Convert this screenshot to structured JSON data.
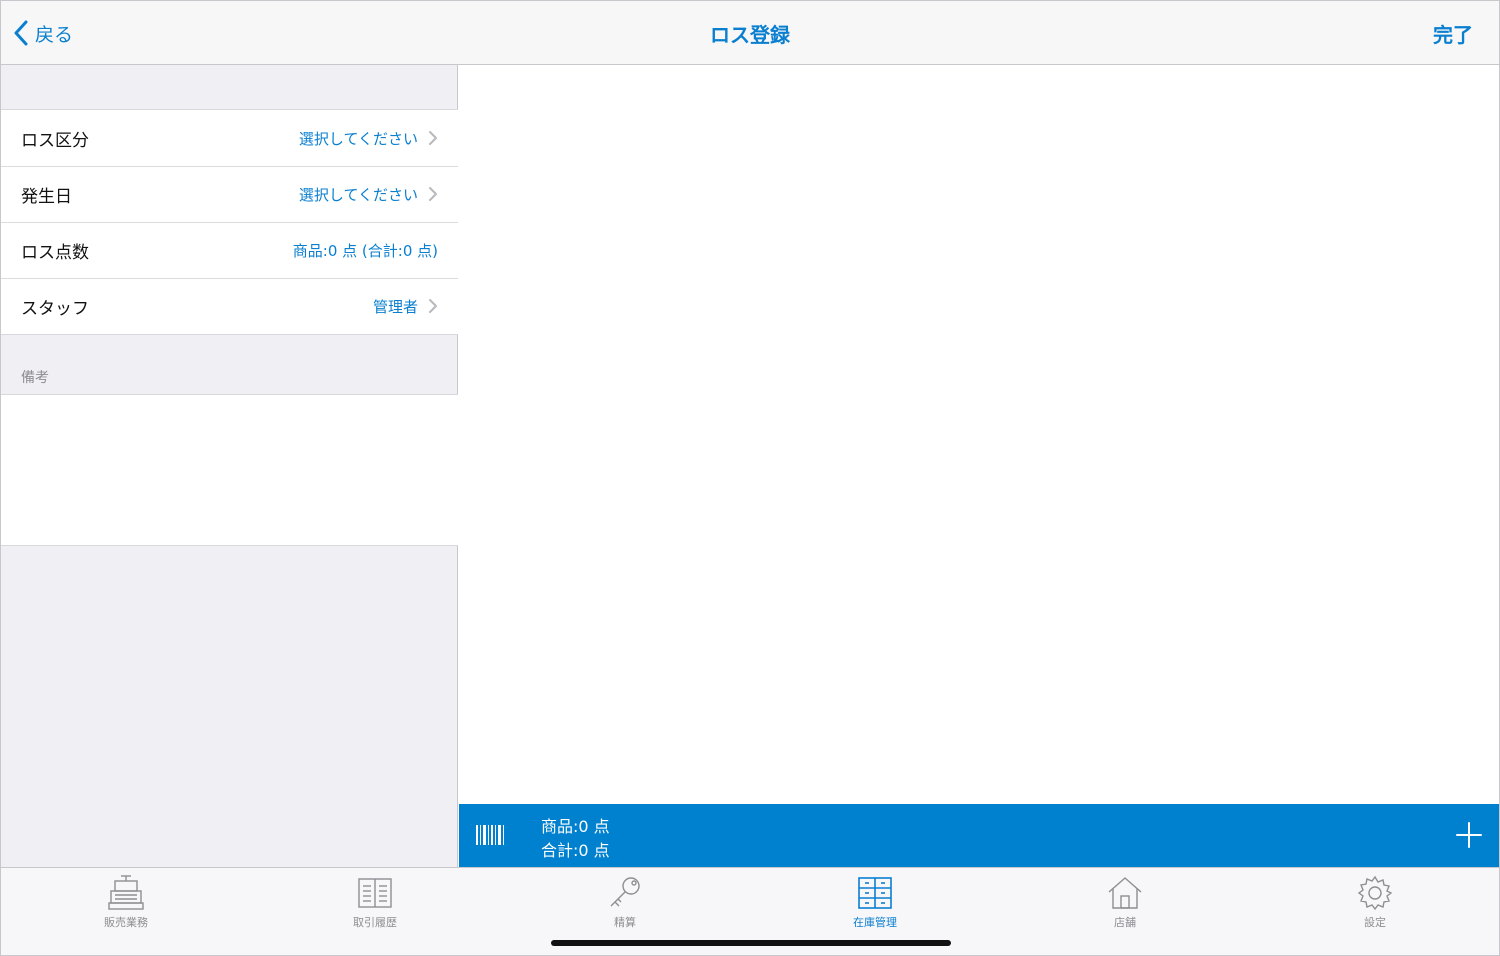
{
  "nav": {
    "back_label": "戻る",
    "title": "ロス登録",
    "done_label": "完了"
  },
  "form": {
    "rows": [
      {
        "label": "ロス区分",
        "value": "選択してください",
        "has_chevron": true
      },
      {
        "label": "発生日",
        "value": "選択してください",
        "has_chevron": true
      },
      {
        "label": "ロス点数",
        "value": "商品:0 点 (合計:0 点)",
        "has_chevron": false
      },
      {
        "label": "スタッフ",
        "value": "管理者",
        "has_chevron": true
      }
    ],
    "notes_header": "備考",
    "notes_value": ""
  },
  "summary": {
    "items_line": "商品:0 点",
    "total_line": "合計:0 点"
  },
  "tabs": [
    {
      "label": "販売業務",
      "icon": "register-icon",
      "active": false
    },
    {
      "label": "取引履歴",
      "icon": "book-icon",
      "active": false
    },
    {
      "label": "精算",
      "icon": "key-icon",
      "active": false
    },
    {
      "label": "在庫管理",
      "icon": "cabinet-icon",
      "active": true
    },
    {
      "label": "店舗",
      "icon": "house-icon",
      "active": false
    },
    {
      "label": "設定",
      "icon": "gear-icon",
      "active": false
    }
  ],
  "colors": {
    "accent": "#0a7fd0",
    "bar": "#0081cf",
    "grouped_bg": "#efeff4",
    "inactive_tab": "#8e8e93"
  }
}
